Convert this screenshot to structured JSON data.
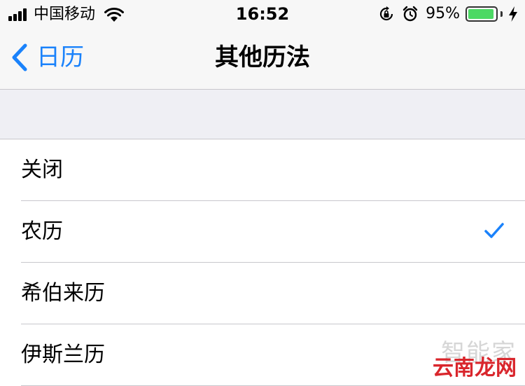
{
  "status_bar": {
    "carrier": "中国移动",
    "time": "16:52",
    "battery_percent": "95%",
    "battery_level": 0.95
  },
  "nav": {
    "back_label": "日历",
    "title": "其他历法"
  },
  "options": [
    {
      "label": "关闭",
      "selected": false
    },
    {
      "label": "农历",
      "selected": true
    },
    {
      "label": "希伯来历",
      "selected": false
    },
    {
      "label": "伊斯兰历",
      "selected": false
    }
  ],
  "watermark": {
    "top": "智能家",
    "bottom": "云南龙网"
  },
  "colors": {
    "accent": "#1a82fb",
    "battery": "#4cd964",
    "watermark_red": "#d9262c"
  }
}
